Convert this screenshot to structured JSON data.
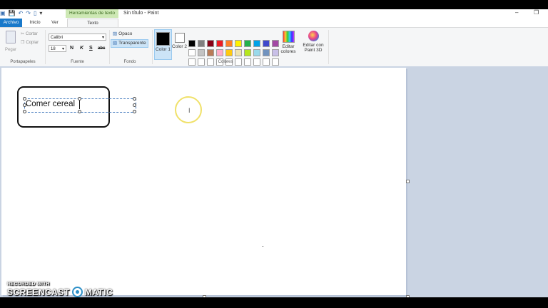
{
  "window": {
    "title": "Sin título - Paint",
    "context_tab": "Herramientas de texto",
    "minimize_glyph": "–",
    "restore_glyph": "❐"
  },
  "tabs": [
    {
      "label": "Archivo"
    },
    {
      "label": "Inicio"
    },
    {
      "label": "Ver"
    },
    {
      "label": "Texto"
    }
  ],
  "ribbon": {
    "clipboard": {
      "paste": "Pegar",
      "cut": "Cortar",
      "copy": "Copiar",
      "group": "Portapapeles"
    },
    "font": {
      "family": "Calibri",
      "size": "18",
      "bold": "N",
      "italic": "K",
      "underline": "S",
      "strike": "abc",
      "group": "Fuente"
    },
    "background": {
      "opaque": "Opaco",
      "transparent": "Transparente",
      "group": "Fondo"
    },
    "colors": {
      "color1": "Color 1",
      "color2": "Color 2",
      "edit": "Editar colores",
      "paint3d": "Editar con Paint 3D",
      "group": "Colores",
      "color1_value": "#000000",
      "color2_value": "#ffffff",
      "palette_row1": [
        "#000000",
        "#7f7f7f",
        "#880015",
        "#ed1c24",
        "#ff7f27",
        "#fff200",
        "#22b14c",
        "#00a2e8",
        "#3f48cc",
        "#a349a4"
      ],
      "palette_row2": [
        "#ffffff",
        "#c3c3c3",
        "#b97a57",
        "#ffaec9",
        "#ffc90e",
        "#efe4b0",
        "#b5e61d",
        "#99d9ea",
        "#7092be",
        "#c8bfe7"
      ],
      "palette_row3": [
        "#ffffff",
        "#ffffff",
        "#ffffff",
        "#ffffff",
        "#ffffff",
        "#ffffff",
        "#ffffff",
        "#ffffff",
        "#ffffff",
        "#ffffff"
      ]
    }
  },
  "canvas": {
    "text": "Comer cereal"
  },
  "watermark": {
    "top": "RECORDED WITH",
    "left": "SCREENCAST",
    "right": "MATIC"
  }
}
